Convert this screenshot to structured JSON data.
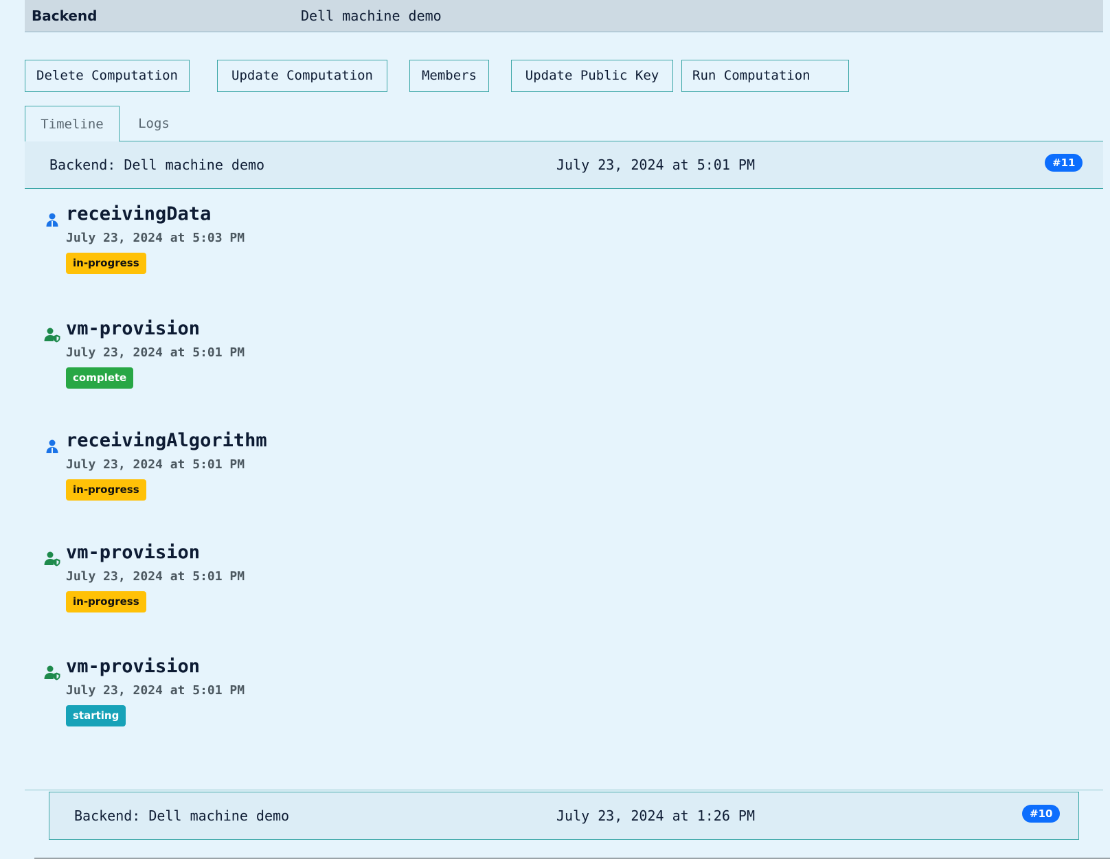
{
  "header": {
    "title": "Backend",
    "subtitle": "Dell machine demo"
  },
  "actions": [
    {
      "label": "Delete Computation"
    },
    {
      "label": "Update Computation"
    },
    {
      "label": "Members"
    },
    {
      "label": "Update Public Key"
    },
    {
      "label": "Run Computation"
    }
  ],
  "tabs": [
    {
      "label": "Timeline",
      "active": true
    },
    {
      "label": "Logs",
      "active": false
    }
  ],
  "computations": [
    {
      "name": "Backend: Dell machine demo",
      "date": "July 23, 2024 at 5:01 PM",
      "badge": "#11",
      "events": [
        {
          "name": "receivingData",
          "date": "July 23, 2024 at 5:03 PM",
          "status": "in-progress",
          "icon": "user-icon"
        },
        {
          "name": "vm-provision",
          "date": "July 23, 2024 at 5:01 PM",
          "status": "complete",
          "icon": "user-shield-icon"
        },
        {
          "name": "receivingAlgorithm",
          "date": "July 23, 2024 at 5:01 PM",
          "status": "in-progress",
          "icon": "user-icon"
        },
        {
          "name": "vm-provision",
          "date": "July 23, 2024 at 5:01 PM",
          "status": "in-progress",
          "icon": "user-shield-icon"
        },
        {
          "name": "vm-provision",
          "date": "July 23, 2024 at 5:01 PM",
          "status": "starting",
          "icon": "user-shield-icon"
        }
      ]
    },
    {
      "name": "Backend: Dell machine demo",
      "date": "July 23, 2024 at 1:26 PM",
      "badge": "#10"
    }
  ],
  "colors": {
    "accent": "#0d6efd",
    "border": "#3aa6a6",
    "in_progress": "#ffc107",
    "complete": "#28a745",
    "starting": "#17a2b8",
    "user_icon": "#1a73e8",
    "shield_icon": "#1e8a4c"
  }
}
